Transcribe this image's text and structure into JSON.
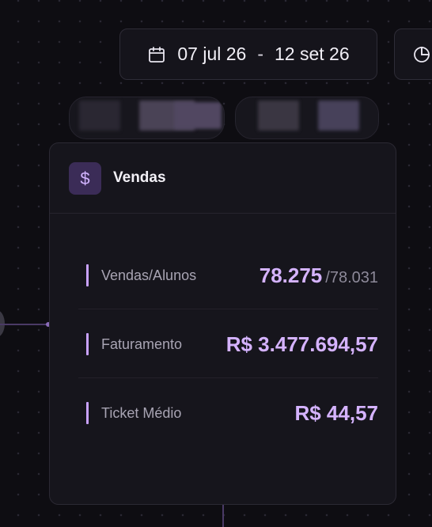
{
  "date_range": {
    "start": "07 jul 26",
    "separator": "-",
    "end": "12 set 26"
  },
  "icons": {
    "calendar": "calendar-icon",
    "chart": "pie-chart-icon",
    "currency": "dollar-icon"
  },
  "card": {
    "icon_glyph": "$",
    "title": "Vendas",
    "rows": [
      {
        "label": "Vendas/Alunos",
        "value": "78.275",
        "sub": "/78.031"
      },
      {
        "label": "Faturamento",
        "value": "R$ 3.477.694,57"
      },
      {
        "label": "Ticket Médio",
        "value": "R$ 44,57"
      }
    ]
  },
  "colors": {
    "accent": "#d5b3ff",
    "accent_bar": "#c9a2ff",
    "icon_bg": "#3b2c57",
    "background": "#0e0d12",
    "card_bg": "#16151c"
  }
}
